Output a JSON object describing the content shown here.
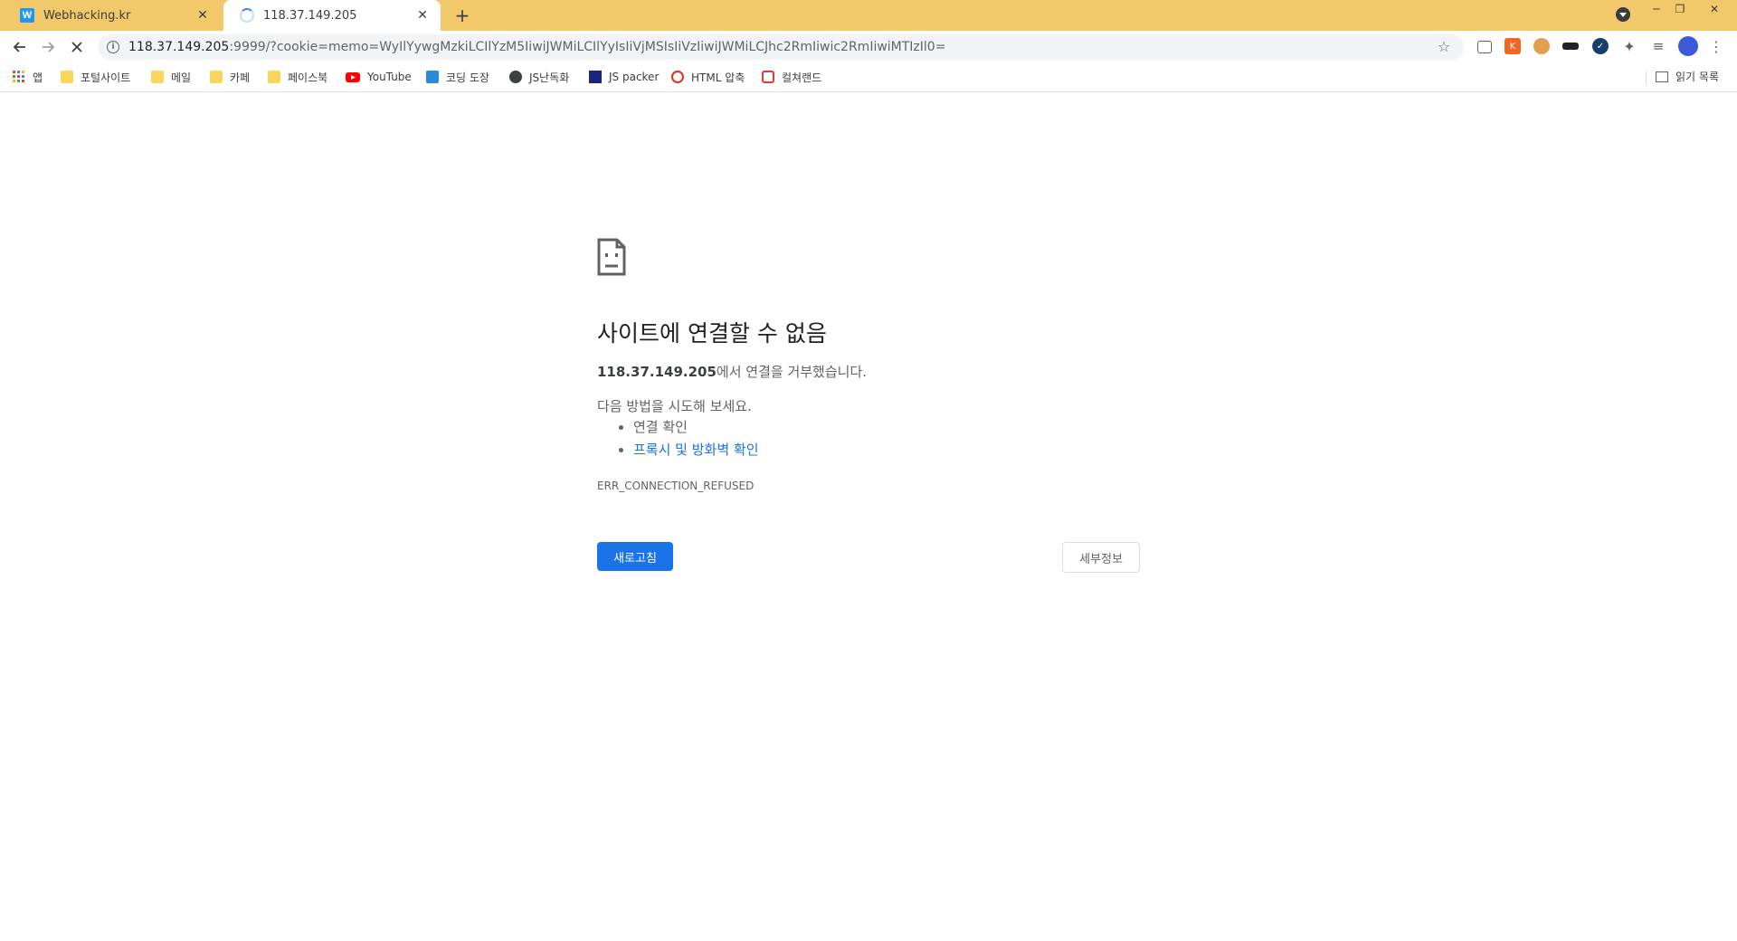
{
  "tabs": [
    {
      "title": "Webhacking.kr",
      "favicon_letter": "W"
    },
    {
      "title": "118.37.149.205"
    }
  ],
  "omnibox": {
    "url_host": "118.37.149.205",
    "url_rest": ":9999/?cookie=memo=WyIlYywgMzkiLCIlYzM5IiwiJWMiLCIlYyIsIiVjMSIsIiVzIiwiJWMiLCJhc2RmIiwic2RmIiwiMTIzIl0="
  },
  "bookmarks": [
    {
      "label": "앱",
      "icon": "apps-grid-icon"
    },
    {
      "label": "포털사이트",
      "icon": "folder-icon"
    },
    {
      "label": "메일",
      "icon": "folder-icon"
    },
    {
      "label": "카페",
      "icon": "folder-icon"
    },
    {
      "label": "페이스북",
      "icon": "folder-icon"
    },
    {
      "label": "YouTube",
      "icon": "youtube-icon"
    },
    {
      "label": "코딩 도장",
      "icon": "coding-dojang-icon"
    },
    {
      "label": "JS난독화",
      "icon": "globe-icon"
    },
    {
      "label": "JS packer",
      "icon": "js-packer-icon"
    },
    {
      "label": "HTML 압축",
      "icon": "html-compress-icon"
    },
    {
      "label": "컬쳐랜드",
      "icon": "cultureland-icon"
    }
  ],
  "reading_list": "읽기 목록",
  "error": {
    "title": "사이트에 연결할 수 없음",
    "host": "118.37.149.205",
    "detail_suffix": "에서 연결을 거부했습니다.",
    "suggest": "다음 방법을 시도해 보세요.",
    "suggestions": [
      "연결 확인",
      "프록시 및 방화벽 확인"
    ],
    "code": "ERR_CONNECTION_REFUSED",
    "reload_label": "새로고침",
    "details_label": "세부정보"
  },
  "colors": {
    "tabstrip": "#f1c86a",
    "accent": "#1a73e8"
  }
}
